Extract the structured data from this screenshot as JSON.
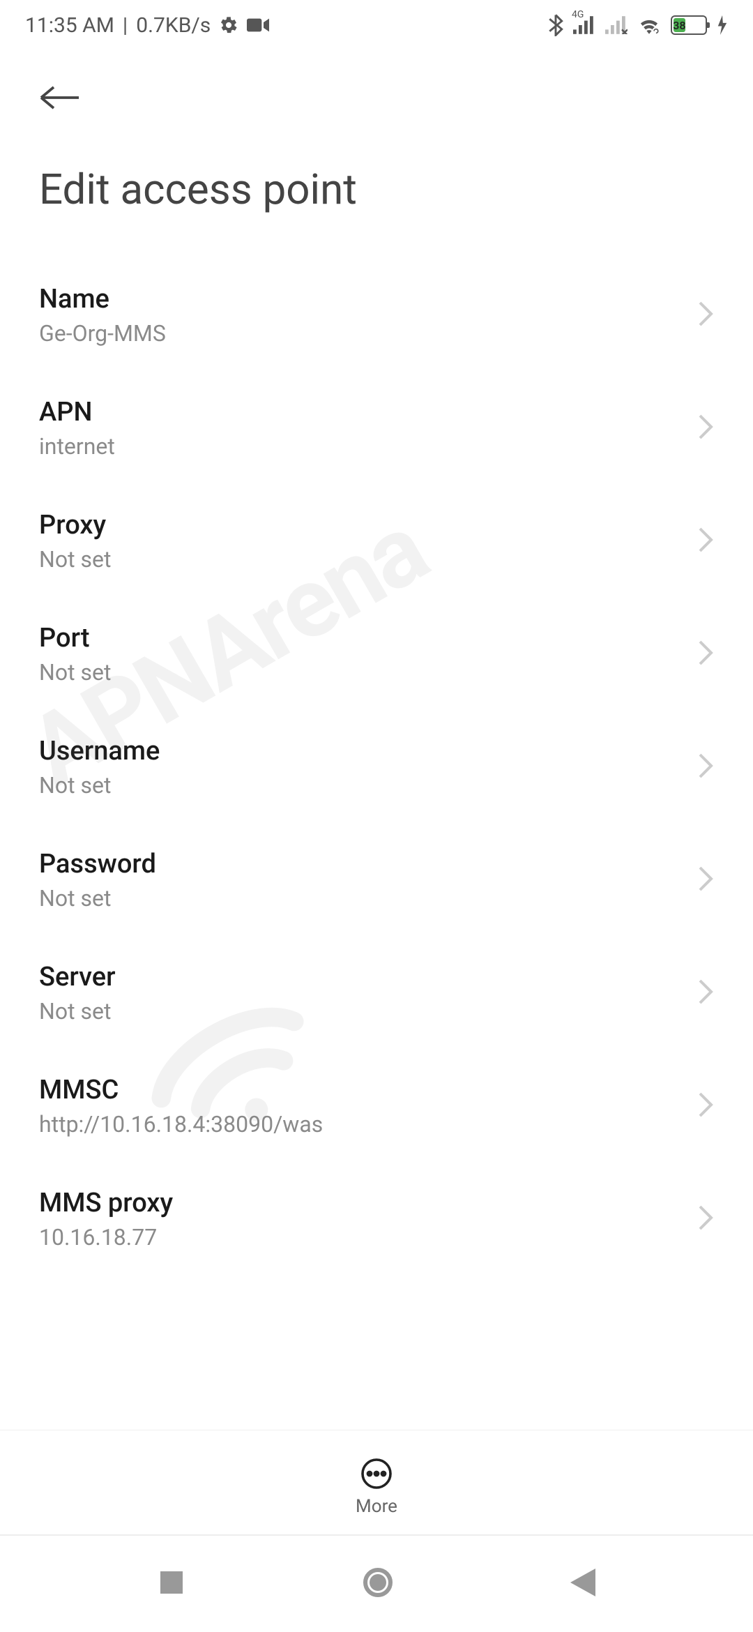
{
  "status": {
    "time": "11:35 AM",
    "separator": "|",
    "data_rate": "0.7KB/s",
    "network_label": "4G",
    "battery_percent": "38"
  },
  "header": {
    "title": "Edit access point"
  },
  "items": [
    {
      "label": "Name",
      "value": "Ge-Org-MMS"
    },
    {
      "label": "APN",
      "value": "internet"
    },
    {
      "label": "Proxy",
      "value": "Not set"
    },
    {
      "label": "Port",
      "value": "Not set"
    },
    {
      "label": "Username",
      "value": "Not set"
    },
    {
      "label": "Password",
      "value": "Not set"
    },
    {
      "label": "Server",
      "value": "Not set"
    },
    {
      "label": "MMSC",
      "value": "http://10.16.18.4:38090/was"
    },
    {
      "label": "MMS proxy",
      "value": "10.16.18.77"
    }
  ],
  "bottom": {
    "more_label": "More"
  },
  "watermark": {
    "text": "APNArena"
  }
}
